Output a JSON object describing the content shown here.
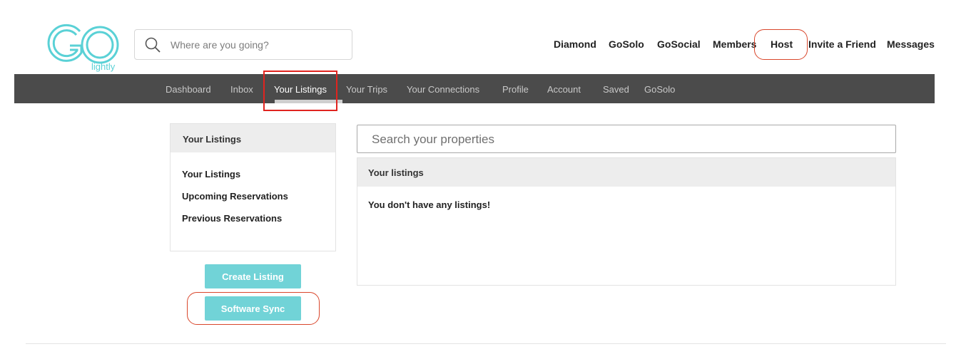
{
  "brand": {
    "logo_text": "lightly",
    "accent_color": "#5ad1d6"
  },
  "search": {
    "placeholder": "Where are you going?",
    "icon": "search-icon"
  },
  "top_nav": [
    "Diamond",
    "GoSolo",
    "GoSocial",
    "Members",
    "Host",
    "Invite a Friend",
    "Messages"
  ],
  "main_nav": {
    "items": [
      "Dashboard",
      "Inbox",
      "Your Listings",
      "Your Trips",
      "Your Connections",
      "Profile",
      "Account",
      "Saved",
      "GoSolo"
    ],
    "active": "Your Listings"
  },
  "sidebar": {
    "title": "Your Listings",
    "links": [
      "Your Listings",
      "Upcoming Reservations",
      "Previous Reservations"
    ]
  },
  "buttons": {
    "create_listing": "Create Listing",
    "software_sync": "Software Sync",
    "color": "#71d3d7"
  },
  "listings": {
    "search_placeholder": "Search your properties",
    "header": "Your listings",
    "empty_message": "You don't have any listings!"
  },
  "annotation_color": "#e0241f"
}
